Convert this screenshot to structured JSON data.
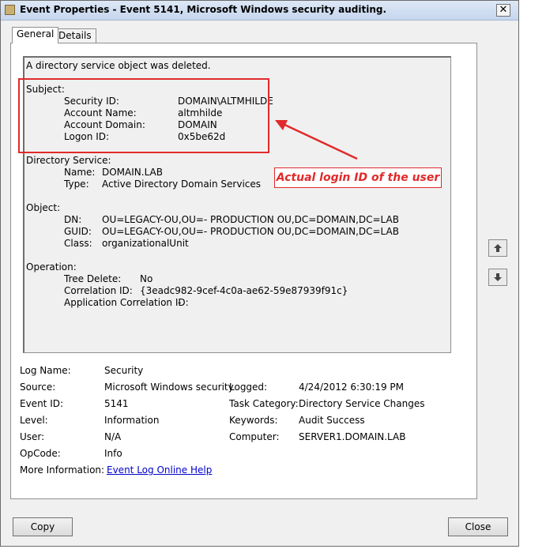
{
  "window": {
    "title": "Event Properties - Event 5141, Microsoft Windows security auditing.",
    "close_glyph": "✕"
  },
  "tabs": [
    {
      "label": "General"
    },
    {
      "label": "Details"
    }
  ],
  "description": {
    "summary": "A directory service object was deleted.",
    "subject_header": "Subject:",
    "subject": [
      {
        "label": "Security ID:",
        "value": "DOMAIN\\ALTMHILDE"
      },
      {
        "label": "Account Name:",
        "value": "altmhilde"
      },
      {
        "label": "Account Domain:",
        "value": "DOMAIN"
      },
      {
        "label": "Logon ID:",
        "value": "0x5be62d"
      }
    ],
    "directory_header": "Directory Service:",
    "directory": [
      {
        "label": "Name:",
        "value": "DOMAIN.LAB"
      },
      {
        "label": "Type:",
        "value": "Active Directory Domain Services"
      }
    ],
    "object_header": "Object:",
    "object": [
      {
        "label": "DN:",
        "value": "OU=LEGACY-OU,OU=- PRODUCTION OU,DC=DOMAIN,DC=LAB"
      },
      {
        "label": "GUID:",
        "value": "OU=LEGACY-OU,OU=- PRODUCTION OU,DC=DOMAIN,DC=LAB"
      },
      {
        "label": "Class:",
        "value": "organizationalUnit"
      }
    ],
    "operation_header": "Operation:",
    "operation": [
      {
        "label": "Tree Delete:",
        "value": "No"
      },
      {
        "label": "Correlation ID:",
        "value": "{3eadc982-9cef-4c0a-ae62-59e87939f91c}"
      },
      {
        "label": "Application Correlation ID:",
        "value": "-"
      }
    ]
  },
  "annotation": {
    "text": "Actual login ID of the user",
    "color": "#e12a2a"
  },
  "details": {
    "log_name_label": "Log Name:",
    "log_name": "Security",
    "source_label": "Source:",
    "source": "Microsoft Windows security",
    "logged_label": "Logged:",
    "logged": "4/24/2012 6:30:19 PM",
    "event_id_label": "Event ID:",
    "event_id": "5141",
    "task_category_label": "Task Category:",
    "task_category": "Directory Service Changes",
    "level_label": "Level:",
    "level": "Information",
    "keywords_label": "Keywords:",
    "keywords": "Audit Success",
    "user_label": "User:",
    "user": "N/A",
    "computer_label": "Computer:",
    "computer": "SERVER1.DOMAIN.LAB",
    "opcode_label": "OpCode:",
    "opcode": "Info",
    "more_info_label": "More Information:",
    "more_info_link": "Event Log Online Help"
  },
  "nav": {
    "up_icon": "arrow-up-icon",
    "down_icon": "arrow-down-icon"
  },
  "buttons": {
    "copy": "Copy",
    "close": "Close"
  }
}
